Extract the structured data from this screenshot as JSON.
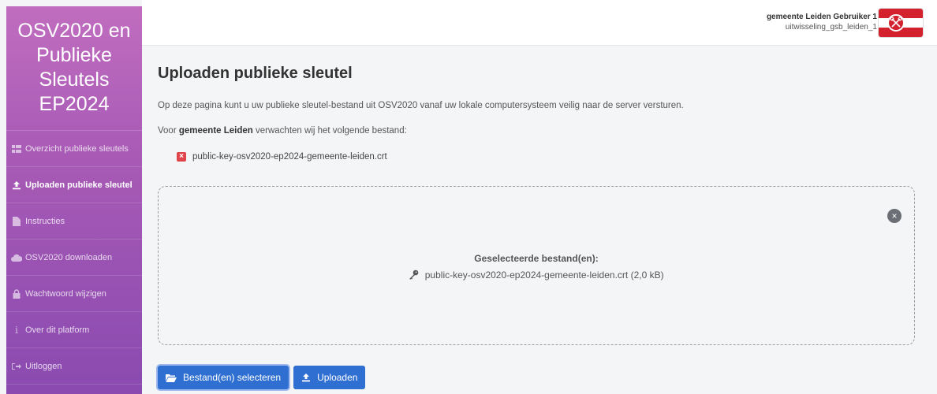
{
  "sidebar": {
    "brand": "OSV2020 en Publieke Sleutels EP2024",
    "items": [
      {
        "label": "Overzicht publieke sleutels",
        "icon": "list-icon",
        "active": false
      },
      {
        "label": "Uploaden publieke sleutel",
        "icon": "upload-icon",
        "active": true
      },
      {
        "label": "Instructies",
        "icon": "document-icon",
        "active": false
      },
      {
        "label": "OSV2020 downloaden",
        "icon": "cloud-download-icon",
        "active": false
      },
      {
        "label": "Wachtwoord wijzigen",
        "icon": "lock-icon",
        "active": false
      },
      {
        "label": "Over dit platform",
        "icon": "info-icon",
        "active": false
      },
      {
        "label": "Uitloggen",
        "icon": "logout-icon",
        "active": false
      }
    ]
  },
  "header": {
    "user_name": "gemeente Leiden Gebruiker 1",
    "user_id": "uitwisseling_gsb_leiden_1",
    "flag_colors": [
      "#d3212e",
      "#ffffff",
      "#d3212e"
    ]
  },
  "main": {
    "title": "Uploaden publieke sleutel",
    "intro": "Op deze pagina kunt u uw publieke sleutel-bestand uit OSV2020 vanaf uw lokale computersysteem veilig naar de server versturen.",
    "expect_prefix": "Voor ",
    "expect_bold": "gemeente Leiden",
    "expect_suffix": " verwachten wij het volgende bestand:",
    "expected_file": "public-key-osv2020-ep2024-gemeente-leiden.crt",
    "dropzone": {
      "selected_title": "Geselecteerde bestand(en):",
      "selected_file": "public-key-osv2020-ep2024-gemeente-leiden.crt (2,0 kB)"
    },
    "buttons": {
      "select": "Bestand(en) selecteren",
      "upload": "Uploaden"
    }
  },
  "colors": {
    "accent": "#2f6fd1",
    "sidebar_top": "#c06dbf",
    "sidebar_bottom": "#8a4ab0",
    "error": "#e0444b"
  }
}
